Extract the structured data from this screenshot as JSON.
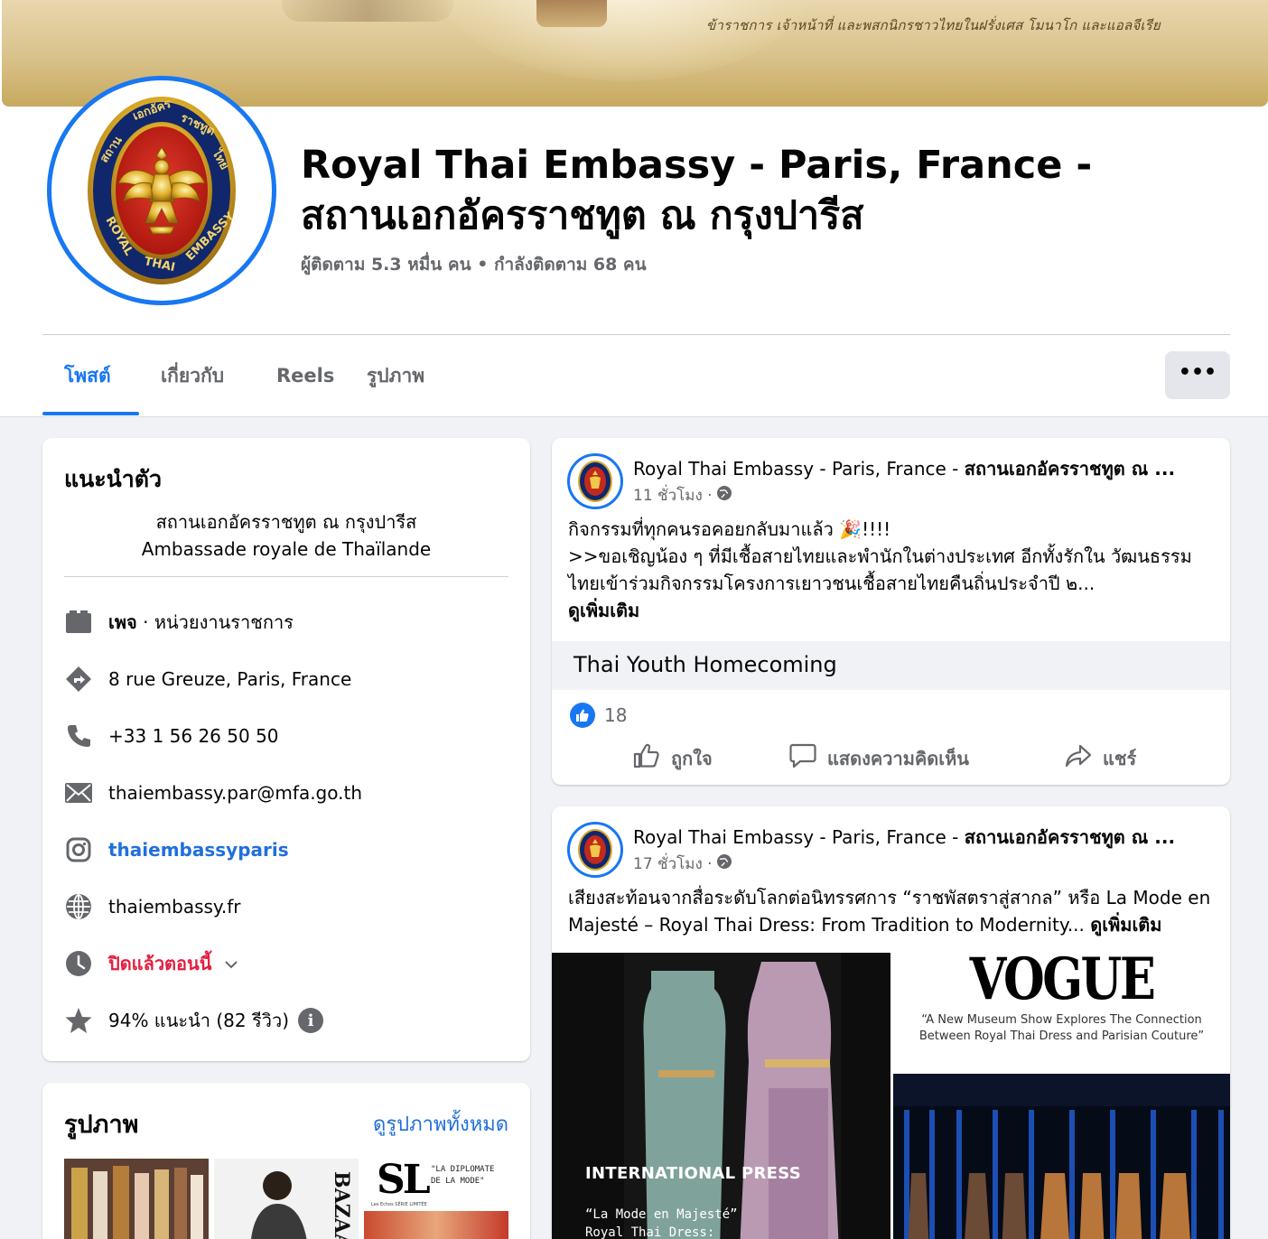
{
  "cover": {
    "caption": "ข้าราชการ เจ้าหน้าที่ และพสกนิกรชาวไทยในฝรั่งเศส โมนาโก และแอลจีเรีย"
  },
  "header": {
    "title": "Royal Thai Embassy - Paris, France - สถานเอกอัครราชทูต ณ กรุงปารีส",
    "stats": "ผู้ติดตาม 5.3 หมื่น คน • กำลังติดตาม 68 คน",
    "logo_text": "สถานเอกอัครราชทูตไทย ROYAL THAI EMBASSY"
  },
  "tabs": [
    {
      "label": "โพสต์",
      "active": true
    },
    {
      "label": "เกี่ยวกับ",
      "active": false
    },
    {
      "label": "Reels",
      "active": false
    },
    {
      "label": "รูปภาพ",
      "active": false
    }
  ],
  "more_label": "•••",
  "intro": {
    "title": "แนะนำตัว",
    "bio_line1": "สถานเอกอัครราชทูต ณ กรุงปารีส",
    "bio_line2": "Ambassade royale de Thaïlande",
    "page_label": "เพจ",
    "category": " · หน่วยงานราชการ",
    "address": "8 rue Greuze, Paris, France",
    "phone": "+33 1 56 26 50 50",
    "email": "thaiembassy.par@mfa.go.th",
    "instagram": "thaiembassyparis",
    "website": "thaiembassy.fr",
    "hours": "ปิดแล้วตอนนี้",
    "rating": "94% แนะนำ (82 รีวิว)",
    "info_badge": "i"
  },
  "photos": {
    "title": "รูปภาพ",
    "see_all": "ดูรูปภาพทั้งหมด",
    "sl_logo": "SL",
    "sl_quote": "\"LA DIPLOMATE DE LA MODE\"",
    "sl_small": "Les Echos SÉRIE LIMITÉE",
    "bazaar_text": "BAZAAR"
  },
  "posts": [
    {
      "author_page": "Royal Thai Embassy - Paris, France - ",
      "author_bold": "สถานเอกอัครราชทูต ณ ...",
      "time": "11 ชั่วโมง ·",
      "line1": "กิจกรรมที่ทุกคนรอคอยกลับมาแล้ว 🎉!!!!",
      "line2": ">>ขอเชิญน้อง ๆ ที่มีเชื้อสายไทยและพำนักในต่างประเทศ อีกทั้งรักใน วัฒนธรรมไทยเข้าร่วมกิจกรรมโครงการเยาวชนเชื้อสายไทยคืนถิ่นประจำปี ๒...",
      "see_more": "ดูเพิ่มเติม",
      "link_title": "Thai Youth Homecoming",
      "like_count": "18",
      "action_like": "ถูกใจ",
      "action_comment": "แสดงความคิดเห็น",
      "action_share": "แชร์"
    },
    {
      "author_page": "Royal Thai Embassy - Paris, France - ",
      "author_bold": "สถานเอกอัครราชทูต ณ ...",
      "time": "17 ชั่วโมง ·",
      "text": "เสียงสะท้อนจากสื่อระดับโลกต่อนิทรรศการ “ราชพัสตราสู่สากล” หรือ La Mode en Majesté – Royal Thai Dress: From Tradition to Modernity... ",
      "see_more": "ดูเพิ่มเติม",
      "media_intl": "INTERNATIONAL PRESS",
      "media_intl_sub1": "“La Mode en Majesté”",
      "media_intl_sub2": "Royal Thai Dress:",
      "vogue": "VOGUE",
      "vogue_quote": "“A New Museum Show Explores The Connection Between Royal Thai Dress and Parisian Couture”"
    }
  ],
  "colors": {
    "accent": "#1877f2",
    "link": "#216fdb",
    "closed": "#e41e3f",
    "secondary_text": "#65676b"
  }
}
